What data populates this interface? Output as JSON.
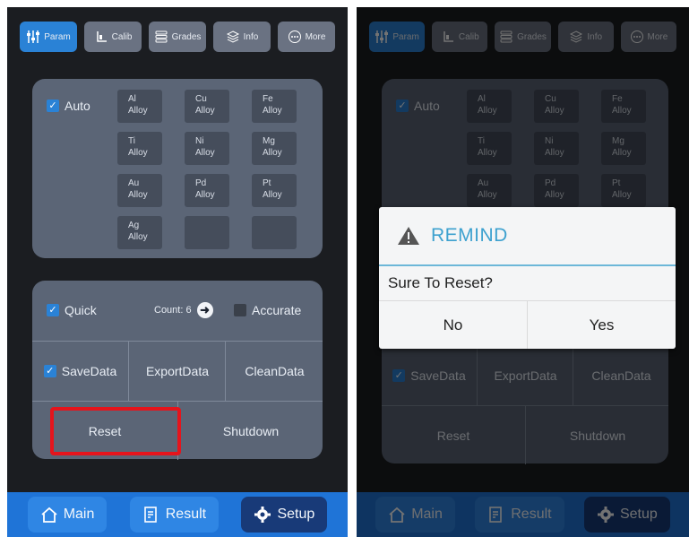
{
  "tabs": [
    {
      "label": "Param",
      "icon": "sliders-icon",
      "active": true
    },
    {
      "label": "Calib",
      "icon": "calib-icon",
      "active": false
    },
    {
      "label": "Grades",
      "icon": "stack-icon",
      "active": false
    },
    {
      "label": "Info",
      "icon": "layers-icon",
      "active": false
    },
    {
      "label": "More",
      "icon": "more-icon",
      "active": false
    }
  ],
  "alloy_panel": {
    "auto_label": "Auto",
    "alloys": [
      {
        "el": "Al",
        "sub": "Alloy"
      },
      {
        "el": "Cu",
        "sub": "Alloy"
      },
      {
        "el": "Fe",
        "sub": "Alloy"
      },
      {
        "el": "Ti",
        "sub": "Alloy"
      },
      {
        "el": "Ni",
        "sub": "Alloy"
      },
      {
        "el": "Mg",
        "sub": "Alloy"
      },
      {
        "el": "Au",
        "sub": "Alloy"
      },
      {
        "el": "Pd",
        "sub": "Alloy"
      },
      {
        "el": "Pt",
        "sub": "Alloy"
      },
      {
        "el": "Ag",
        "sub": "Alloy"
      }
    ]
  },
  "controls": {
    "quick_label": "Quick",
    "count_label": "Count: 6",
    "accurate_label": "Accurate",
    "savedata_label": "SaveData",
    "exportdata_label": "ExportData",
    "cleandata_label": "CleanData",
    "reset_label": "Reset",
    "shutdown_label": "Shutdown"
  },
  "nav": {
    "main_label": "Main",
    "result_label": "Result",
    "setup_label": "Setup"
  },
  "dialog": {
    "title": "REMIND",
    "message": "Sure To Reset?",
    "no_label": "No",
    "yes_label": "Yes"
  },
  "colors": {
    "accent": "#2a82d6",
    "highlight": "#e5141c",
    "dialog_title": "#3da1cf"
  }
}
